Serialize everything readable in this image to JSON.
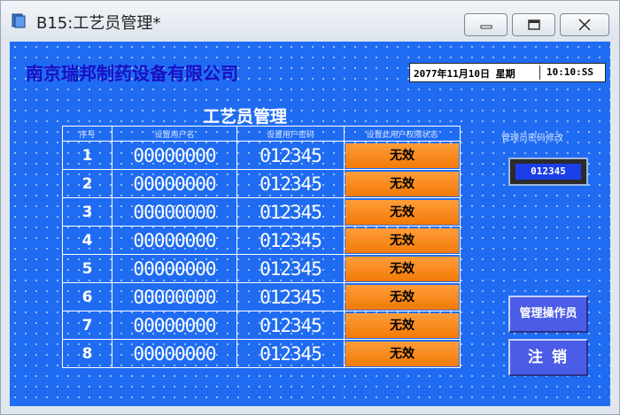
{
  "window": {
    "title": "B15:工艺员管理*"
  },
  "header": {
    "company": "南京瑞邦制药设备有限公司",
    "date": "2077年11月10日 星期",
    "time": "10:10:SS"
  },
  "panel": {
    "title": "工艺员管理",
    "columns": [
      "序号",
      "设置用户名",
      "设置用户密码",
      "设置此用户权限状态"
    ],
    "rows": [
      {
        "index": "1",
        "user": "00000000",
        "password": "012345",
        "status": "无效"
      },
      {
        "index": "2",
        "user": "00000000",
        "password": "012345",
        "status": "无效"
      },
      {
        "index": "3",
        "user": "00000000",
        "password": "012345",
        "status": "无效"
      },
      {
        "index": "4",
        "user": "00000000",
        "password": "012345",
        "status": "无效"
      },
      {
        "index": "5",
        "user": "00000000",
        "password": "012345",
        "status": "无效"
      },
      {
        "index": "6",
        "user": "00000000",
        "password": "012345",
        "status": "无效"
      },
      {
        "index": "7",
        "user": "00000000",
        "password": "012345",
        "status": "无效"
      },
      {
        "index": "8",
        "user": "00000000",
        "password": "012345",
        "status": "无效"
      }
    ]
  },
  "side": {
    "password_label": "管理员密码修改",
    "password_value": "012345",
    "manage_button": "管理操作员",
    "logout_button": "注销"
  },
  "colors": {
    "background": "#1f6cf2",
    "status_button": "#f37a07",
    "action_button": "#4b5ce6",
    "company_text": "#1a0fc4"
  }
}
